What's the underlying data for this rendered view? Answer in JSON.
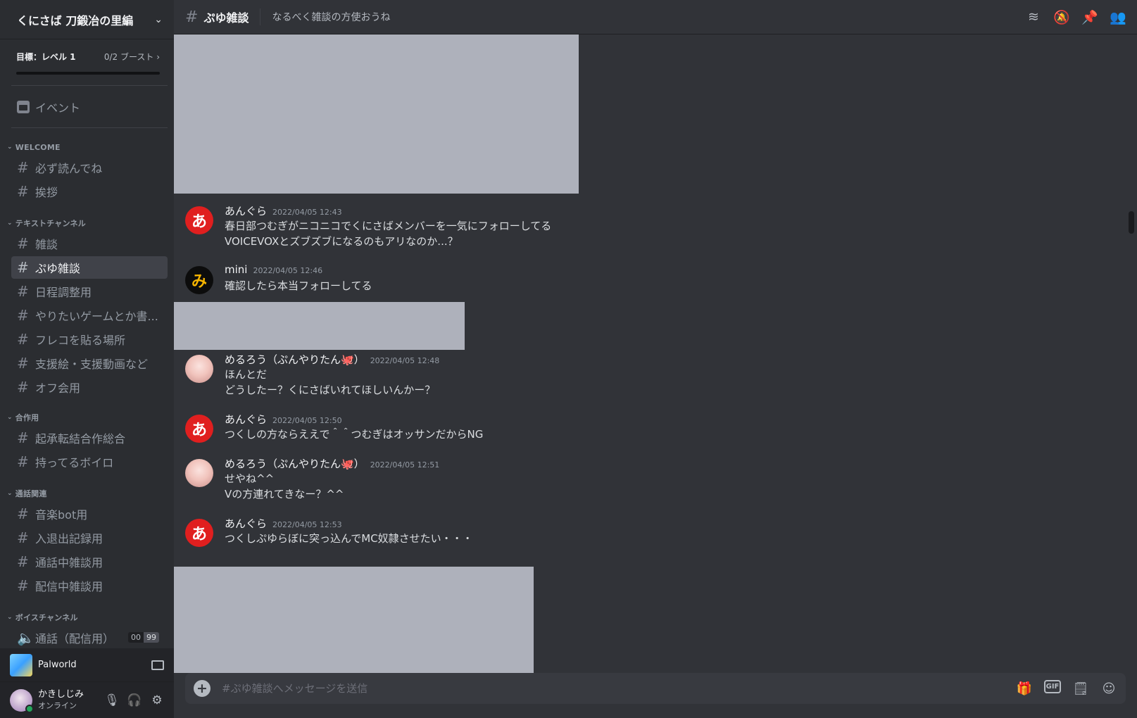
{
  "server": {
    "name": "くにさば 刀鍛冶の里編",
    "chevron_icon": "chevron-down-icon"
  },
  "boost": {
    "goal": "目標：レベル 1",
    "count": "0/2 ブースト",
    "progress": 0.0
  },
  "events": {
    "label": "イベント"
  },
  "categories": [
    {
      "name": "WELCOME",
      "channels": [
        {
          "name": "必ず読んでね"
        },
        {
          "name": "挨拶"
        }
      ]
    },
    {
      "name": "テキストチャンネル",
      "channels": [
        {
          "name": "雑談"
        },
        {
          "name": "ぷゆ雑談",
          "active": true
        },
        {
          "name": "日程調整用"
        },
        {
          "name": "やりたいゲームとか書..."
        },
        {
          "name": "フレコを貼る場所"
        },
        {
          "name": "支援絵・支援動画など"
        },
        {
          "name": "オフ会用"
        }
      ]
    },
    {
      "name": "合作用",
      "channels": [
        {
          "name": "起承転結合作総合"
        },
        {
          "name": "持ってるボイロ"
        }
      ]
    },
    {
      "name": "通話関連",
      "channels": [
        {
          "name": "音楽bot用"
        },
        {
          "name": "入退出記録用"
        },
        {
          "name": "通話中雑談用"
        },
        {
          "name": "配信中雑談用"
        }
      ]
    },
    {
      "name": "ボイスチャンネル",
      "channels": [
        {
          "name": "通話（配信用）",
          "voice": true,
          "badge_left": "00",
          "badge_right": "99"
        }
      ]
    }
  ],
  "activity": {
    "name": "Palworld"
  },
  "user": {
    "name": "かきしじみ",
    "status": "オンライン"
  },
  "channel": {
    "name": "ぷゆ雑談",
    "topic": "なるべく雑談の方使おうね"
  },
  "messages": [
    {
      "author": "あんぐら",
      "avatar": "あ",
      "timestamp": "2022/04/05 12:43",
      "lines": [
        "春日部つむぎがニコニコでくにさばメンバーを一気にフォローしてる",
        "VOICEVOXとズブズブになるのもアリなのか...？"
      ]
    },
    {
      "author": "mini",
      "avatar": "み",
      "timestamp": "2022/04/05 12:46",
      "lines": [
        "確認したら本当フォローしてる"
      ]
    },
    {
      "author": "めるろう（ぷんやりたん🐙）",
      "avatar": "",
      "timestamp": "2022/04/05 12:48",
      "lines": [
        "ほんとだ",
        "どうしたー？くにさばいれてほしいんかー？"
      ]
    },
    {
      "author": "あんぐら",
      "avatar": "あ",
      "timestamp": "2022/04/05 12:50",
      "lines": [
        "つくしの方ならええで＾＾つむぎはオッサンだからNG"
      ]
    },
    {
      "author": "めるろう（ぷんやりたん🐙）",
      "avatar": "",
      "timestamp": "2022/04/05 12:51",
      "lines": [
        "せやね^^",
        "Vの方連れてきなー？^^"
      ]
    },
    {
      "author": "あんぐら",
      "avatar": "あ",
      "timestamp": "2022/04/05 12:53",
      "lines": [
        "つくしぷゆらぼに突っ込んでMC奴隷させたい・・・"
      ]
    }
  ],
  "composer": {
    "placeholder": "#ぷゆ雑談へメッセージを送信"
  },
  "colors": {
    "background": "#313338",
    "sidebar": "#2b2d31",
    "active_channel": "#404249",
    "avatar_red": "#e01f1f",
    "online": "#23a55a"
  }
}
